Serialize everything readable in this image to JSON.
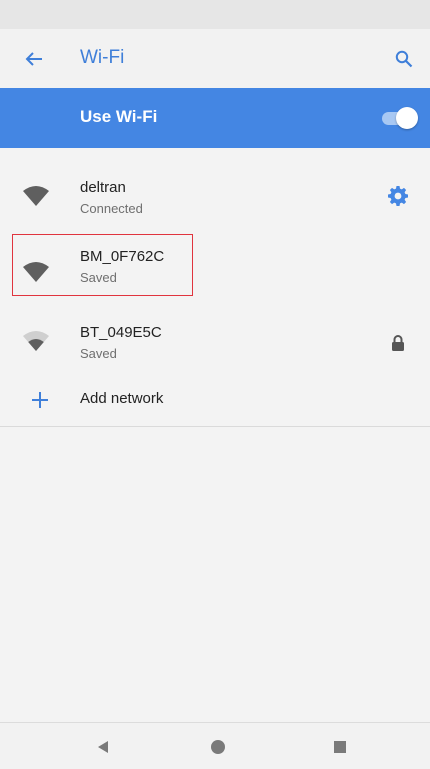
{
  "app_bar": {
    "title": "Wi-Fi",
    "back_icon": "arrow-left-icon",
    "search_icon": "search-icon"
  },
  "wifi_toggle": {
    "label": "Use Wi-Fi",
    "on": true
  },
  "networks": [
    {
      "name": "deltran",
      "status": "Connected",
      "signal": "full",
      "trailing_icon": "gear-icon"
    },
    {
      "name": "BM_0F762C",
      "status": "Saved",
      "signal": "full",
      "highlighted": true
    },
    {
      "name": "BT_049E5C",
      "status": "Saved",
      "signal": "weak",
      "trailing_icon": "lock-icon"
    }
  ],
  "add_network": {
    "label": "Add network",
    "icon": "plus-icon"
  },
  "colors": {
    "accent": "#4486e3",
    "title": "#3f7fd9",
    "highlight": "#e0343e"
  },
  "nav": [
    "back-icon",
    "home-icon",
    "recents-icon"
  ]
}
